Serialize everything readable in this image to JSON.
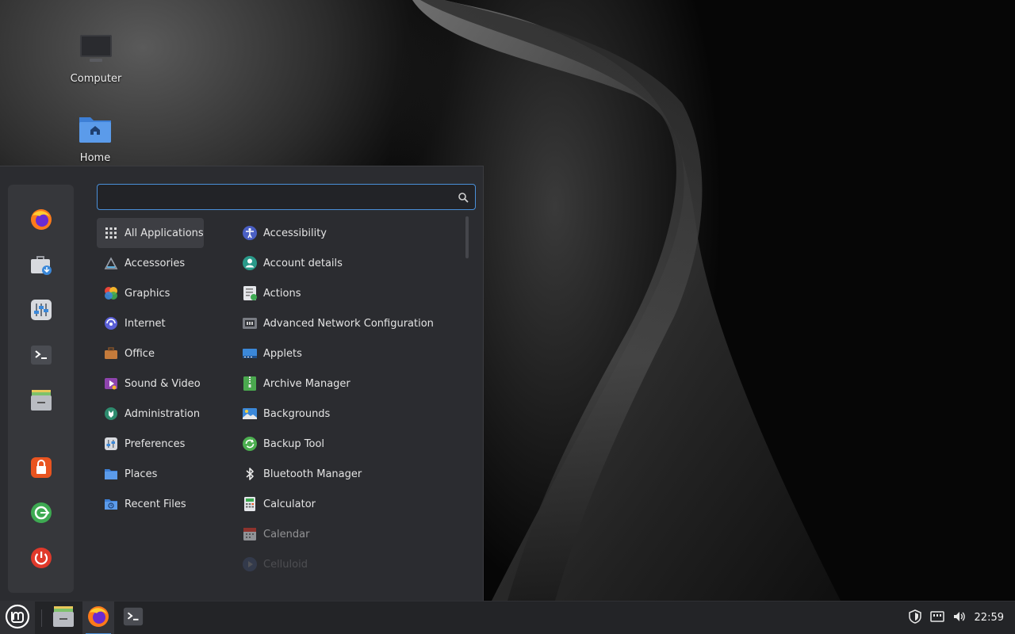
{
  "desktop": {
    "icons": [
      {
        "label": "Computer",
        "icon": "monitor-icon"
      },
      {
        "label": "Home",
        "icon": "home-folder-icon"
      }
    ]
  },
  "menu": {
    "search": {
      "value": "",
      "placeholder": ""
    },
    "favorites": [
      {
        "name": "Firefox",
        "icon": "firefox-icon"
      },
      {
        "name": "Software Manager",
        "icon": "software-manager-icon"
      },
      {
        "name": "System Settings",
        "icon": "settings-icon"
      },
      {
        "name": "Terminal",
        "icon": "terminal-icon"
      },
      {
        "name": "Files",
        "icon": "files-icon"
      }
    ],
    "session": [
      {
        "name": "Lock Screen",
        "icon": "lock-icon"
      },
      {
        "name": "Log Out",
        "icon": "logout-icon"
      },
      {
        "name": "Quit",
        "icon": "power-icon"
      }
    ],
    "categories": [
      {
        "label": "All Applications",
        "icon": "grid-icon",
        "selected": true
      },
      {
        "label": "Accessories",
        "icon": "accessories-icon"
      },
      {
        "label": "Graphics",
        "icon": "graphics-icon"
      },
      {
        "label": "Internet",
        "icon": "internet-icon"
      },
      {
        "label": "Office",
        "icon": "office-icon"
      },
      {
        "label": "Sound & Video",
        "icon": "sound-video-icon"
      },
      {
        "label": "Administration",
        "icon": "administration-icon"
      },
      {
        "label": "Preferences",
        "icon": "preferences-icon"
      },
      {
        "label": "Places",
        "icon": "places-folder-icon"
      },
      {
        "label": "Recent Files",
        "icon": "recent-files-icon"
      }
    ],
    "apps": [
      {
        "label": "Accessibility",
        "icon": "accessibility-icon"
      },
      {
        "label": "Account details",
        "icon": "account-icon"
      },
      {
        "label": "Actions",
        "icon": "actions-icon"
      },
      {
        "label": "Advanced Network Configuration",
        "icon": "network-icon"
      },
      {
        "label": "Applets",
        "icon": "applets-icon"
      },
      {
        "label": "Archive Manager",
        "icon": "archive-icon"
      },
      {
        "label": "Backgrounds",
        "icon": "backgrounds-icon"
      },
      {
        "label": "Backup Tool",
        "icon": "backup-icon"
      },
      {
        "label": "Bluetooth Manager",
        "icon": "bluetooth-icon"
      },
      {
        "label": "Calculator",
        "icon": "calculator-icon"
      },
      {
        "label": "Calendar",
        "icon": "calendar-icon"
      },
      {
        "label": "Celluloid",
        "icon": "celluloid-icon"
      }
    ]
  },
  "taskbar": {
    "clock": "22:59",
    "launchers": [
      {
        "name": "Files",
        "icon": "files-icon"
      },
      {
        "name": "Firefox",
        "icon": "firefox-icon"
      },
      {
        "name": "Terminal",
        "icon": "terminal-icon"
      }
    ],
    "tray": [
      {
        "name": "Update Manager",
        "icon": "shield-icon"
      },
      {
        "name": "Network",
        "icon": "network-wired-icon"
      },
      {
        "name": "Volume",
        "icon": "volume-icon"
      }
    ]
  },
  "colors": {
    "accent": "#4a90d9",
    "menu_bg": "#2b2c30",
    "panel_bg": "#232427"
  }
}
